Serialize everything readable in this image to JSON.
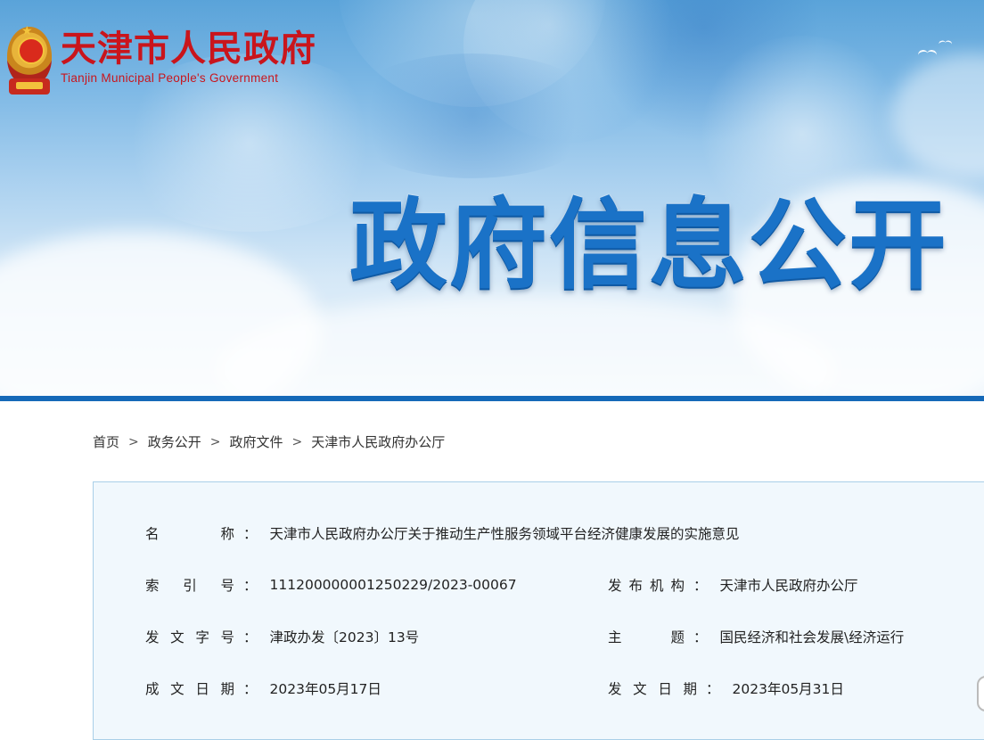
{
  "header": {
    "site_name_cn": "天津市人民政府",
    "site_name_en": "Tianjin Municipal People's Government",
    "banner_title": "政府信息公开",
    "colors": {
      "primary_blue": "#1569b8",
      "logo_red": "#c9151c",
      "title_blue": "#1a72c7"
    }
  },
  "breadcrumb": {
    "items": [
      "首页",
      "政务公开",
      "政府文件",
      "天津市人民政府办公厅"
    ],
    "separator": ">"
  },
  "document_info": {
    "name": {
      "label": [
        "名",
        "称"
      ],
      "value": "天津市人民政府办公厅关于推动生产性服务领域平台经济健康发展的实施意见"
    },
    "index_no": {
      "label": [
        "索",
        "引",
        "号"
      ],
      "value": "11120000000125022​9/2023-00067"
    },
    "publisher": {
      "label": [
        "发",
        "布",
        "机",
        "构"
      ],
      "value": "天津市人民政府办公厅"
    },
    "doc_no": {
      "label": [
        "发",
        "文",
        "字",
        "号"
      ],
      "value": "津政办发〔2023〕13号"
    },
    "subject": {
      "label": [
        "主",
        "题"
      ],
      "value": "国民经济和社会发展\\经济运行"
    },
    "created_date": {
      "label": [
        "成",
        "文",
        "日",
        "期"
      ],
      "value": "2023年05月17日"
    },
    "issued_date": {
      "label": [
        "发",
        "文",
        "日",
        "期"
      ],
      "value": "2023年05月31日"
    },
    "colon": "："
  }
}
